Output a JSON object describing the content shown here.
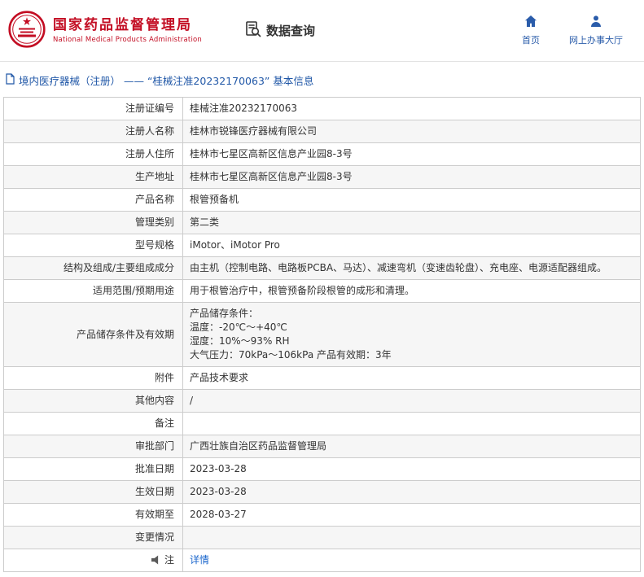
{
  "header": {
    "agency_cn": "国家药品监督管理局",
    "agency_en": "National Medical Products Administration",
    "nav_data_query": "数据查询",
    "nav_home": "首页",
    "nav_service_hall": "网上办事大厅"
  },
  "breadcrumb": {
    "text": "境内医疗器械（注册） —— “桂械注准20232170063” 基本信息"
  },
  "colors": {
    "brand_red": "#c30d23",
    "link_blue": "#2a5caa",
    "breadcrumb_blue": "#2057a7",
    "detail_link_blue": "#1a66cc"
  },
  "table": {
    "rows": [
      {
        "label": "注册证编号",
        "value": "桂械注准20232170063"
      },
      {
        "label": "注册人名称",
        "value": "桂林市锐锋医疗器械有限公司"
      },
      {
        "label": "注册人住所",
        "value": "桂林市七星区高新区信息产业园8-3号"
      },
      {
        "label": "生产地址",
        "value": "桂林市七星区高新区信息产业园8-3号"
      },
      {
        "label": "产品名称",
        "value": "根管预备机"
      },
      {
        "label": "管理类别",
        "value": "第二类"
      },
      {
        "label": "型号规格",
        "value": "iMotor、iMotor Pro"
      },
      {
        "label": "结构及组成/主要组成成分",
        "value": "由主机（控制电路、电路板PCBA、马达）、减速弯机（变速齿轮盘）、充电座、电源适配器组成。"
      },
      {
        "label": "适用范围/预期用途",
        "value": "用于根管治疗中，根管预备阶段根管的成形和清理。"
      },
      {
        "label": "产品储存条件及有效期",
        "value": "产品储存条件：\n温度：-20℃～+40℃\n湿度：10%～93% RH\n大气压力：70kPa～106kPa 产品有效期：3年"
      },
      {
        "label": "附件",
        "value": "产品技术要求"
      },
      {
        "label": "其他内容",
        "value": "/"
      },
      {
        "label": "备注",
        "value": ""
      },
      {
        "label": "审批部门",
        "value": "广西壮族自治区药品监督管理局"
      },
      {
        "label": "批准日期",
        "value": "2023-03-28"
      },
      {
        "label": "生效日期",
        "value": "2023-03-28"
      },
      {
        "label": "有效期至",
        "value": "2028-03-27"
      },
      {
        "label": "变更情况",
        "value": ""
      },
      {
        "label": "注",
        "icon": "announcement",
        "link": "详情"
      }
    ]
  }
}
